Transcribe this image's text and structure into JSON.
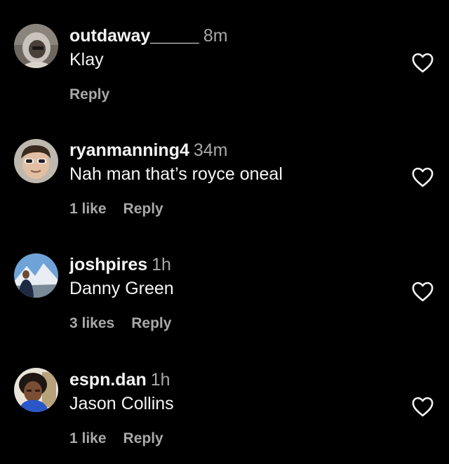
{
  "comments": [
    {
      "username": "outdaway_____",
      "time": "8m",
      "text": "Klay",
      "likes": "",
      "reply_label": "Reply",
      "avatar_icon": "avatar-hooded-person",
      "heart_icon": "heart-outline-icon"
    },
    {
      "username": "ryanmanning4",
      "time": "34m",
      "text": "Nah man that’s royce oneal",
      "likes": "1 like",
      "reply_label": "Reply",
      "avatar_icon": "avatar-sunglasses-person",
      "heart_icon": "heart-outline-icon"
    },
    {
      "username": "joshpires",
      "time": "1h",
      "text": "Danny Green",
      "likes": "3 likes",
      "reply_label": "Reply",
      "avatar_icon": "avatar-mountain-person",
      "heart_icon": "heart-outline-icon"
    },
    {
      "username": "espn.dan",
      "time": "1h",
      "text": "Jason Collins",
      "likes": "1 like",
      "reply_label": "Reply",
      "avatar_icon": "avatar-curly-hair-person",
      "heart_icon": "heart-outline-icon"
    }
  ],
  "colors": {
    "background": "#000000",
    "primary_text": "#f5f5f5",
    "secondary_text": "#a8a8a8"
  }
}
